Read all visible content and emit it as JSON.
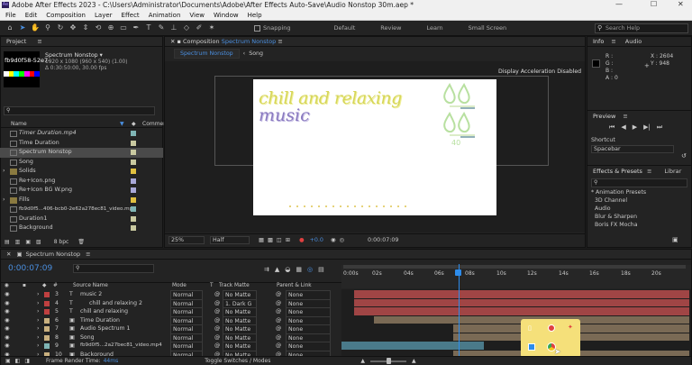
{
  "window": {
    "title": "Adobe After Effects 2023 - C:\\Users\\Administrator\\Documents\\Adobe\\After Effects Auto-Save\\Audio Nonstop 30m.aep *",
    "min": "—",
    "max": "☐",
    "close": "✕"
  },
  "menu": [
    "File",
    "Edit",
    "Composition",
    "Layer",
    "Effect",
    "Animation",
    "View",
    "Window",
    "Help"
  ],
  "toolbar": {
    "snapping": "Snapping",
    "workspaces": [
      "Default",
      "Review",
      "Learn",
      "Small Screen"
    ],
    "search_placeholder": "Search Help"
  },
  "project": {
    "title": "Project",
    "thumb_name": "fb9d0f58-52e7-",
    "sel_name": "Spectrum Nonstop ▾",
    "sel_info1": "1920 x 1080 (960 x 540) (1.00)",
    "sel_info2": "Δ 0:30:50:00, 30.00 fps",
    "col_name": "Name",
    "col_comment": "Comment",
    "bpc": "8 bpc",
    "items": [
      {
        "name": "Timer Duration.mp4",
        "color": "#7fb5b5"
      },
      {
        "name": "Time Duration",
        "color": "#c9c9a0"
      },
      {
        "name": "Spectrum Nonstop",
        "color": "#c9c9a0"
      },
      {
        "name": "Song",
        "color": "#c9c9a0"
      },
      {
        "name": "Solids",
        "color": "#e0c040"
      },
      {
        "name": "Re+Icon.png",
        "color": "#a8a8d8"
      },
      {
        "name": "Re+Icon BG W.png",
        "color": "#a8a8d8"
      },
      {
        "name": "Fills",
        "color": "#e0c040"
      },
      {
        "name": "fb9d0f5...406-bcb0-2e62a278ec81_video.mp4",
        "color": "#7fb5b5"
      },
      {
        "name": "Duration1",
        "color": "#c9c9a0"
      },
      {
        "name": "Background",
        "color": "#c9c9a0"
      }
    ]
  },
  "comp": {
    "title": "Composition",
    "comp_name": "Spectrum Nonstop",
    "tabs": [
      "Spectrum Nonstop",
      "Song"
    ],
    "accel": "Display Acceleration Disabled",
    "text_line1": "chill and relaxing",
    "text_line2": "music",
    "number": "40",
    "zoom": "25%",
    "quality": "Half",
    "exposure": "+0.0",
    "timecode": "0:00:07:09"
  },
  "info": {
    "tab_info": "Info",
    "tab_audio": "Audio",
    "r": "R :",
    "g": "G :",
    "b": "B :",
    "a": "A : 0",
    "x": "X : 2604",
    "y": "Y : 948"
  },
  "preview": {
    "title": "Preview",
    "shortcut_label": "Shortcut",
    "shortcut_value": "Spacebar"
  },
  "effects": {
    "title": "Effects & Presets",
    "tab2": "Librar",
    "search_placeholder": "",
    "items": [
      "* Animation Presets",
      "3D Channel",
      "Audio",
      "Blur & Sharpen",
      "Boris FX Mocha"
    ]
  },
  "timeline": {
    "tab": "Spectrum Nonstop",
    "timecode": "0:00:07:09",
    "col_source": "Source Name",
    "col_mode": "Mode",
    "col_t": "T",
    "col_trkmat": "Track Matte",
    "col_parent": "Parent & Link",
    "ruler": [
      "0:00s",
      "02s",
      "04s",
      "06s",
      "08s",
      "10s",
      "12s",
      "14s",
      "16s",
      "18s",
      "20s"
    ],
    "footer_left": "Frame Render Time:",
    "footer_time": "44ms",
    "footer_mid": "Toggle Switches / Modes",
    "layers": [
      {
        "num": "3",
        "type": "T",
        "name": "music 2",
        "mode": "Normal",
        "matte": "No Matte",
        "parent": "None",
        "label": "#c04040"
      },
      {
        "num": "4",
        "type": "T",
        "name": "chill and relaxing 2",
        "mode": "Normal",
        "matte": "1. Dark G",
        "parent": "None",
        "label": "#c04040"
      },
      {
        "num": "5",
        "type": "T",
        "name": "chill and relaxing",
        "mode": "Normal",
        "matte": "No Matte",
        "parent": "None",
        "label": "#c04040"
      },
      {
        "num": "6",
        "type": "▣",
        "name": "Time Duration",
        "mode": "Normal",
        "matte": "No Matte",
        "parent": "None",
        "label": "#c9b07f"
      },
      {
        "num": "7",
        "type": "▣",
        "name": "Audio Spectrum 1",
        "mode": "Normal",
        "matte": "No Matte",
        "parent": "None",
        "label": "#c9b07f"
      },
      {
        "num": "8",
        "type": "▣",
        "name": "Song",
        "mode": "Normal",
        "matte": "No Matte",
        "parent": "None",
        "label": "#c9b07f"
      },
      {
        "num": "9",
        "type": "▣",
        "name": "fb9d0f5...2a27bec81_video.mp4",
        "mode": "Normal",
        "matte": "No Matte",
        "parent": "None",
        "label": "#7fb5b5"
      },
      {
        "num": "10",
        "type": "▣",
        "name": "Background",
        "mode": "Normal",
        "matte": "No Matte",
        "parent": "None",
        "label": "#c9b07f"
      }
    ]
  },
  "colors": {
    "accent": "#2d8ceb",
    "title_text": "#d6d65a",
    "subtitle_text": "#8a7ac0",
    "drop_green": "#b8e0a0",
    "layer_red": "#a04545",
    "layer_tan": "#7a6a55",
    "layer_teal": "#4a7a8a",
    "popup": "#f5e07a"
  }
}
